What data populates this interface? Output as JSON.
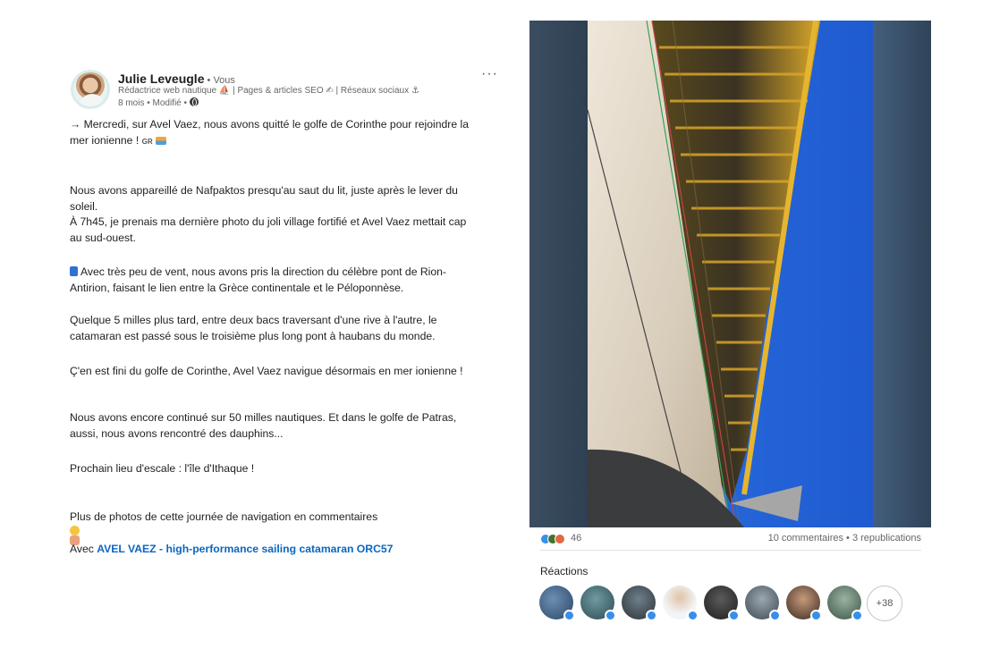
{
  "post": {
    "author_name": "Julie Leveugle",
    "author_badge": " • Vous",
    "headline": "Rédactrice web nautique ⛵ | Pages & articles SEO ✍ | Réseaux sociaux ⚓",
    "meta": "8 mois • Modifié •",
    "more_label": "···",
    "p1_line1": "→ Mercredi, sur Avel Vaez, nous avons quitté le golfe de Corinthe pour rejoindre la",
    "p1_line2": "mer ionienne !",
    "p1_tag": "GR",
    "p2_line1": "Nous avons appareillé de Nafpaktos presqu'au saut du lit, juste après le lever du",
    "p2_line2": "soleil.",
    "p2_line3": "À 7h45, je prenais ma dernière photo du joli village fortifié et Avel Vaez mettait cap",
    "p2_line4": "au sud-ouest.",
    "p3_line1": "Avec très peu de vent, nous avons pris la direction du célèbre pont de Rion-",
    "p3_line2": "Antirion, faisant le lien entre la Grèce continentale et le Péloponnèse.",
    "p4_line1": "Quelque 5 milles plus tard, entre deux bacs traversant d'une rive à l'autre, le",
    "p4_line2": "catamaran est passé sous le troisième plus long pont à haubans du monde.",
    "p5_line1": "Ç'en est fini du golfe de Corinthe, Avel Vaez navigue désormais en mer ionienne !",
    "p6_line1": "Nous avons encore continué sur 50 milles nautiques. Et dans le golfe de Patras,",
    "p6_line2": "aussi, nous avons rencontré des dauphins...",
    "p7_line1": "Prochain lieu d'escale : l'île d'Ithaque !",
    "p8_line1": "Plus de photos de cette journée de navigation en commentaires",
    "p9_prefix": "Avec ",
    "p9_link": "AVEL VAEZ - high-performance sailing catamaran ORC57"
  },
  "social": {
    "reaction_count": "46",
    "comments_reposts": "10 commentaires • 3 republications",
    "reactions_title": "Réactions",
    "more_reactors": "+38"
  },
  "colors": {
    "link": "#0a66c2",
    "like_blue": "#378fe9",
    "celebrate_green": "#44712e",
    "support_orange": "#e16745"
  },
  "icons": [
    "more-icon",
    "globe-icon",
    "like-reaction-icon",
    "celebrate-reaction-icon",
    "support-reaction-icon"
  ]
}
